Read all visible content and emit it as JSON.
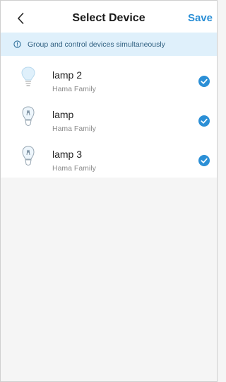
{
  "header": {
    "back_icon": "chevron-left-icon",
    "title": "Select Device",
    "save_label": "Save"
  },
  "banner": {
    "icon": "info-icon",
    "text": "Group and control devices simultaneously"
  },
  "devices": [
    {
      "name": "lamp 2",
      "family": "Hama Family",
      "icon": "bulb-icon",
      "selected": true
    },
    {
      "name": "lamp",
      "family": "Hama Family",
      "icon": "bulb-filament-icon",
      "selected": true
    },
    {
      "name": "lamp 3",
      "family": "Hama Family",
      "icon": "bulb-filament-icon",
      "selected": true
    }
  ],
  "colors": {
    "accent": "#2b8fd6",
    "check": "#2b8fd6",
    "banner_bg": "#dff0fb",
    "banner_text": "#2f5f80"
  }
}
